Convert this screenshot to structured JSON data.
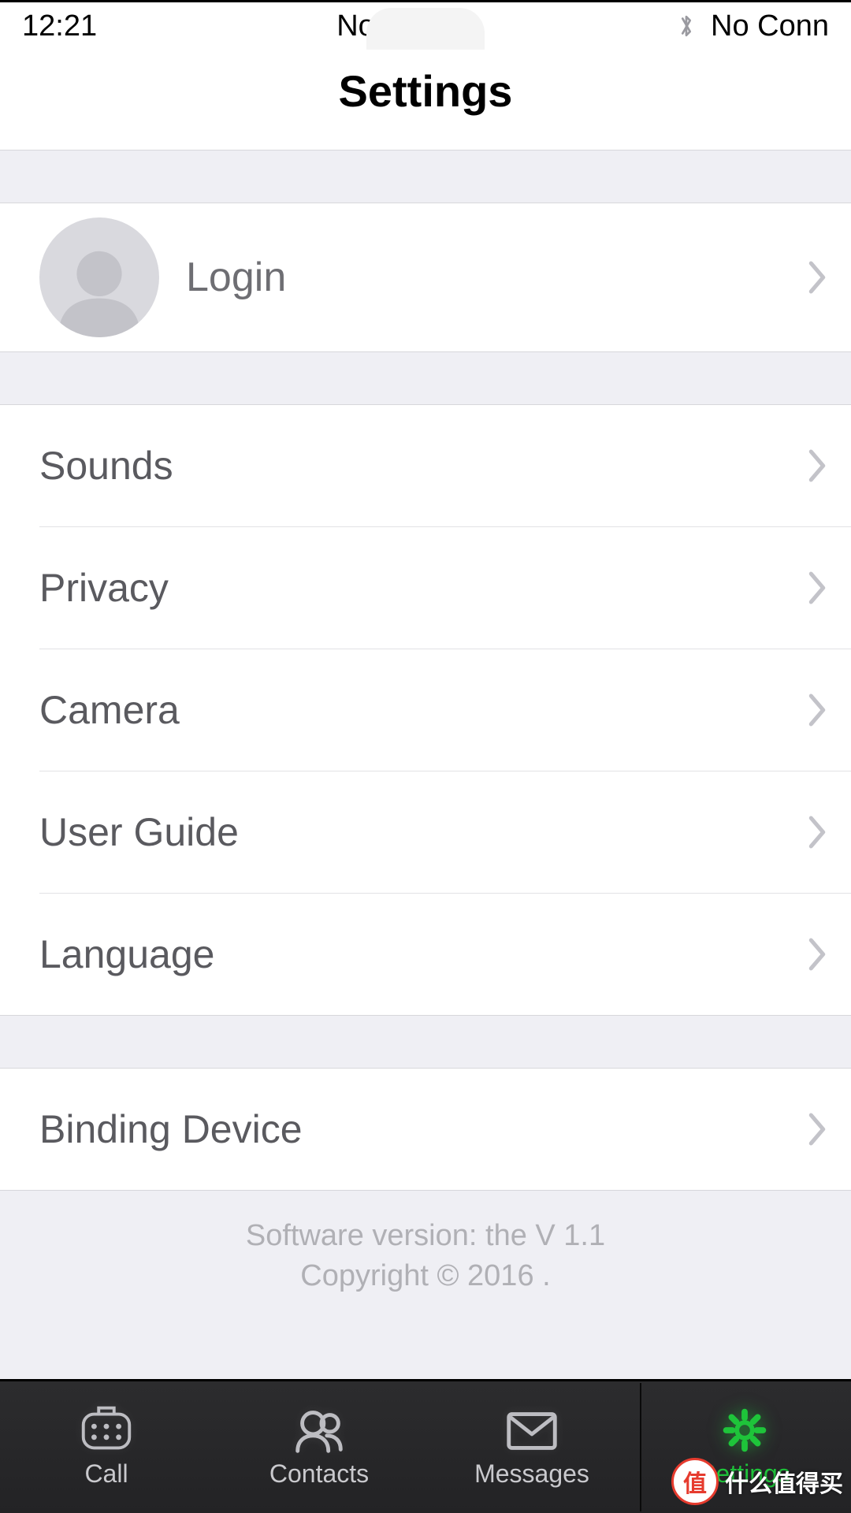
{
  "status": {
    "time": "12:21",
    "carrier": "No SIM",
    "connection": "No Conn"
  },
  "header": {
    "title": "Settings"
  },
  "login": {
    "label": "Login"
  },
  "settings": {
    "items": [
      {
        "label": "Sounds"
      },
      {
        "label": "Privacy"
      },
      {
        "label": "Camera"
      },
      {
        "label": "User Guide"
      },
      {
        "label": "Language"
      }
    ]
  },
  "binding": {
    "label": "Binding Device"
  },
  "footer": {
    "line1": "Software version: the V 1.1",
    "line2": "Copyright © 2016 ."
  },
  "tabs": {
    "items": [
      {
        "label": "Call"
      },
      {
        "label": "Contacts"
      },
      {
        "label": "Messages"
      },
      {
        "label": "Settings"
      }
    ]
  },
  "watermark": {
    "badge": "值",
    "text": "什么值得买"
  }
}
